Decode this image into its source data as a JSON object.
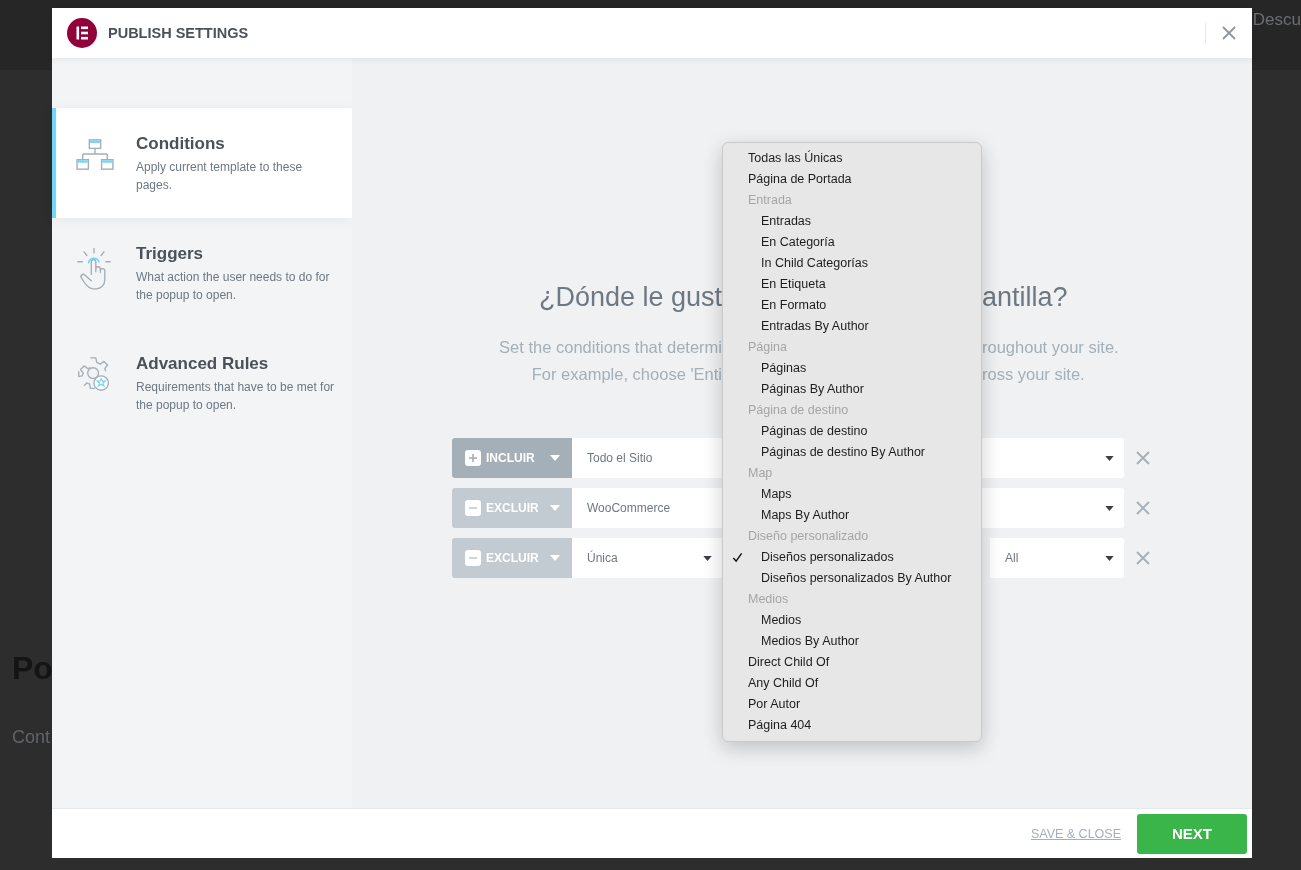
{
  "background": {
    "top_right_text": "Descu",
    "left_texts": [
      "Po",
      "Cont"
    ]
  },
  "window": {
    "title": "PUBLISH SETTINGS"
  },
  "sidebar": {
    "items": [
      {
        "title": "Conditions",
        "description": "Apply current template to these pages.",
        "selected": true,
        "kind": "sitemap"
      },
      {
        "title": "Triggers",
        "description": "What action the user needs to do for the popup to open.",
        "selected": false,
        "kind": "tap"
      },
      {
        "title": "Advanced Rules",
        "description": "Requirements that have to be met for the popup to open.",
        "selected": false,
        "kind": "gear"
      }
    ]
  },
  "main": {
    "heading_left": "¿Dónde le gust",
    "heading_right": "antilla?",
    "description_lines": [
      {
        "left": "Set the conditions that determi",
        "right": "roughout your site."
      },
      {
        "left": "For example, choose 'Enti",
        "right": "ross your site."
      }
    ]
  },
  "conditions": [
    {
      "kind": "include",
      "type_label": "INCLUIR",
      "fields": [
        "Todo el Sitio"
      ]
    },
    {
      "kind": "exclude",
      "type_label": "EXCLUIR",
      "fields": [
        "WooCommerce"
      ]
    },
    {
      "kind": "exclude",
      "type_label": "EXCLUIR",
      "fields": [
        "Única",
        "All"
      ]
    }
  ],
  "dropdown": {
    "items": [
      {
        "kind": "option",
        "label": "Todas las Únicas",
        "selected": false
      },
      {
        "kind": "option",
        "label": "Página de Portada",
        "selected": false
      },
      {
        "kind": "group",
        "label": "Entrada",
        "children": [
          {
            "label": "Entradas",
            "selected": false
          },
          {
            "label": "En Categoría",
            "selected": false
          },
          {
            "label": "In Child Categorías",
            "selected": false
          },
          {
            "label": "En Etiqueta",
            "selected": false
          },
          {
            "label": "En Formato",
            "selected": false
          },
          {
            "label": "Entradas By Author",
            "selected": false
          }
        ]
      },
      {
        "kind": "group",
        "label": "Página",
        "children": [
          {
            "label": "Páginas",
            "selected": false
          },
          {
            "label": "Páginas By Author",
            "selected": false
          }
        ]
      },
      {
        "kind": "group",
        "label": "Página de destino",
        "children": [
          {
            "label": "Páginas de destino",
            "selected": false
          },
          {
            "label": "Páginas de destino By Author",
            "selected": false
          }
        ]
      },
      {
        "kind": "group",
        "label": "Map",
        "children": [
          {
            "label": "Maps",
            "selected": false
          },
          {
            "label": "Maps By Author",
            "selected": false
          }
        ]
      },
      {
        "kind": "group",
        "label": "Diseño personalizado",
        "children": [
          {
            "label": "Diseños personalizados",
            "selected": true
          },
          {
            "label": "Diseños personalizados By Author",
            "selected": false
          }
        ]
      },
      {
        "kind": "group",
        "label": "Medios",
        "children": [
          {
            "label": "Medios",
            "selected": false
          },
          {
            "label": "Medios By Author",
            "selected": false
          }
        ]
      },
      {
        "kind": "option",
        "label": "Direct Child Of",
        "selected": false
      },
      {
        "kind": "option",
        "label": "Any Child Of",
        "selected": false
      },
      {
        "kind": "option",
        "label": "Por Autor",
        "selected": false
      },
      {
        "kind": "option",
        "label": "Página 404",
        "selected": false
      }
    ]
  },
  "footer": {
    "save_label": "SAVE & CLOSE",
    "next_label": "NEXT"
  }
}
